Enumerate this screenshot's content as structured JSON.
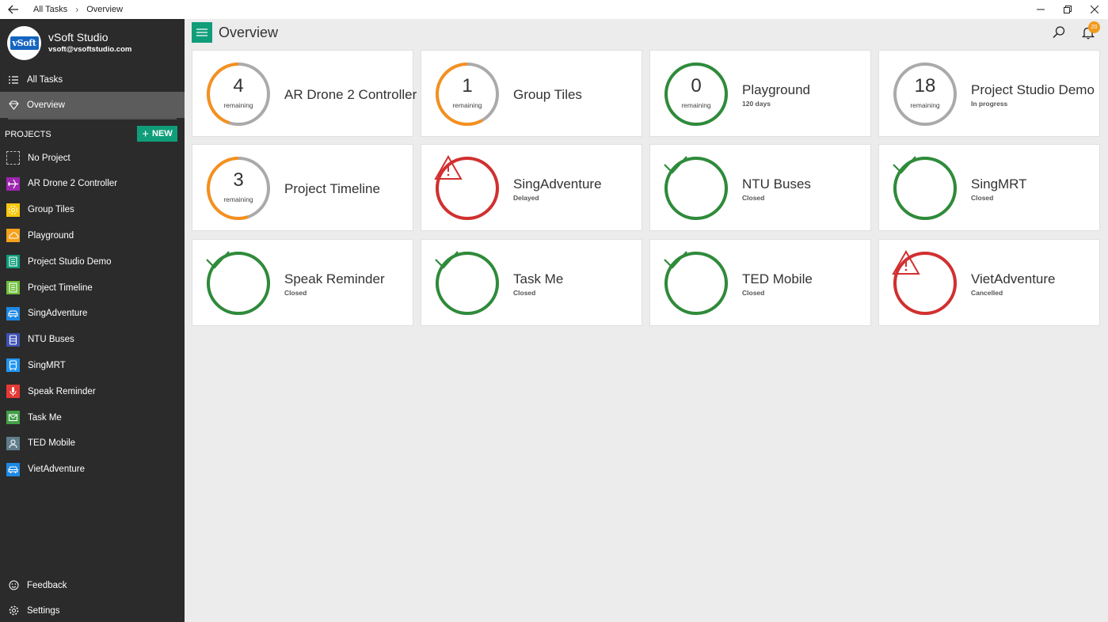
{
  "titlebar": {
    "breadcrumb_root": "All Tasks",
    "breadcrumb_current": "Overview"
  },
  "profile": {
    "name": "vSoft Studio",
    "email": "vsoft@vsoftstudio.com",
    "logo_text": "vSoft"
  },
  "nav": {
    "all_tasks": "All Tasks",
    "overview": "Overview",
    "feedback": "Feedback",
    "settings": "Settings"
  },
  "projects_section": {
    "label": "PROJECTS",
    "new_label": "NEW"
  },
  "projects": [
    {
      "label": "No Project",
      "color": "",
      "icon": "dashed-square-icon"
    },
    {
      "label": "AR Drone 2 Controller",
      "color": "#9c27b0",
      "icon": "plane-icon"
    },
    {
      "label": "Group Tiles",
      "color": "#f9c80e",
      "icon": "flower-icon"
    },
    {
      "label": "Playground",
      "color": "#f5a21b",
      "icon": "cloud-icon"
    },
    {
      "label": "Project Studio Demo",
      "color": "#0f9d7a",
      "icon": "document-icon"
    },
    {
      "label": "Project Timeline",
      "color": "#6ebf3a",
      "icon": "document-icon"
    },
    {
      "label": "SingAdventure",
      "color": "#1e88e5",
      "icon": "car-icon"
    },
    {
      "label": "NTU Buses",
      "color": "#3f51b5",
      "icon": "bus-icon"
    },
    {
      "label": "SingMRT",
      "color": "#2196f3",
      "icon": "train-icon"
    },
    {
      "label": "Speak Reminder",
      "color": "#e53935",
      "icon": "microphone-icon"
    },
    {
      "label": "Task Me",
      "color": "#43a047",
      "icon": "mail-icon"
    },
    {
      "label": "TED Mobile",
      "color": "#607d8b",
      "icon": "person-icon"
    },
    {
      "label": "VietAdventure",
      "color": "#1e88e5",
      "icon": "car-icon"
    }
  ],
  "main": {
    "title": "Overview",
    "notification_count": "20"
  },
  "tiles": [
    {
      "title": "AR Drone 2 Controller",
      "count": "4",
      "count_label": "remaining",
      "subtitle": "",
      "status": "progress",
      "progress": 0.45,
      "ring_color": "#f5901e"
    },
    {
      "title": "Group Tiles",
      "count": "1",
      "count_label": "remaining",
      "subtitle": "",
      "status": "progress",
      "progress": 0.58,
      "ring_color": "#f5901e"
    },
    {
      "title": "Playground",
      "count": "0",
      "count_label": "remaining",
      "subtitle": "120 days",
      "status": "progress",
      "progress": 1.0,
      "ring_color": "#2e8b3a"
    },
    {
      "title": "Project Studio Demo",
      "count": "18",
      "count_label": "remaining",
      "subtitle": "In progress",
      "status": "progress",
      "progress": 0.0,
      "ring_color": "#aaaaaa"
    },
    {
      "title": "Project Timeline",
      "count": "3",
      "count_label": "remaining",
      "subtitle": "",
      "status": "progress",
      "progress": 0.55,
      "ring_color": "#f5901e"
    },
    {
      "title": "SingAdventure",
      "count": "",
      "count_label": "",
      "subtitle": "Delayed",
      "status": "warning",
      "progress": 1.0,
      "ring_color": "#d32f2f"
    },
    {
      "title": "NTU Buses",
      "count": "",
      "count_label": "",
      "subtitle": "Closed",
      "status": "check",
      "progress": 1.0,
      "ring_color": "#2e8b3a"
    },
    {
      "title": "SingMRT",
      "count": "",
      "count_label": "",
      "subtitle": "Closed",
      "status": "check",
      "progress": 1.0,
      "ring_color": "#2e8b3a"
    },
    {
      "title": "Speak Reminder",
      "count": "",
      "count_label": "",
      "subtitle": "Closed",
      "status": "check",
      "progress": 1.0,
      "ring_color": "#2e8b3a"
    },
    {
      "title": "Task Me",
      "count": "",
      "count_label": "",
      "subtitle": "Closed",
      "status": "check",
      "progress": 1.0,
      "ring_color": "#2e8b3a"
    },
    {
      "title": "TED Mobile",
      "count": "",
      "count_label": "",
      "subtitle": "Closed",
      "status": "check",
      "progress": 1.0,
      "ring_color": "#2e8b3a"
    },
    {
      "title": "VietAdventure",
      "count": "",
      "count_label": "",
      "subtitle": "Cancelled",
      "status": "warning",
      "progress": 1.0,
      "ring_color": "#d32f2f"
    }
  ]
}
